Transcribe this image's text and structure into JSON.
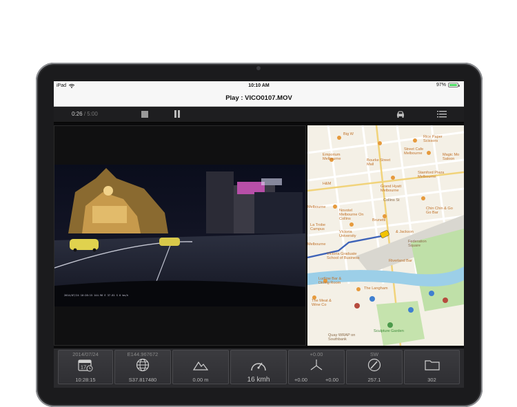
{
  "status_bar": {
    "device": "iPad",
    "time": "10:10 AM",
    "battery": "97%",
    "battery_fraction": 0.97
  },
  "nav": {
    "title": "Play : VICO0107.MOV"
  },
  "player": {
    "elapsed": "0:26",
    "duration": "/ 5:00"
  },
  "video": {
    "overlay_text": "2014/07/24  10:28:15  144.96 E 37.81 S  0 km/h"
  },
  "map": {
    "labels": [
      "Big W",
      "Emporium Melbourne",
      "Bourke Street Mall",
      "Rice Paper Scissors",
      "Street Cafe Melbourne",
      "Magic Mo Saloon",
      "Grand Hyatt Melbourne",
      "Stamford Plaza Melbourne",
      "Collins St",
      "Chin Chin & Go Go Bar",
      "Novotel Melbourne On Collins",
      "Brunetti",
      "La Trobe Campus",
      "Victoria University",
      "& Jackson",
      "Federation Square",
      "Victoria Graduate School of Business",
      "Riverland Bar",
      "Ludlow Bar & Dining Room",
      "The Langham",
      "The Meat & Wine Co",
      "Sculpture Garden",
      "Quay WRAP on Southbank",
      "H&M",
      "Melbourne",
      "Melbourne"
    ]
  },
  "toolbar": {
    "date_top": "2014/07/24",
    "date_bottom": "10:28:15",
    "lon_top": "E144.967672",
    "lon_bottom": "S37.817480",
    "alt_bottom": "0.00 m",
    "speed_bottom": "16 kmh",
    "gsensor_top": "+0.00",
    "gsensor_left": "+0.00",
    "gsensor_right": "+0.00",
    "heading_top": "SW",
    "heading_bottom": "257.1",
    "files_bottom": "302",
    "calendar_day": "17"
  }
}
